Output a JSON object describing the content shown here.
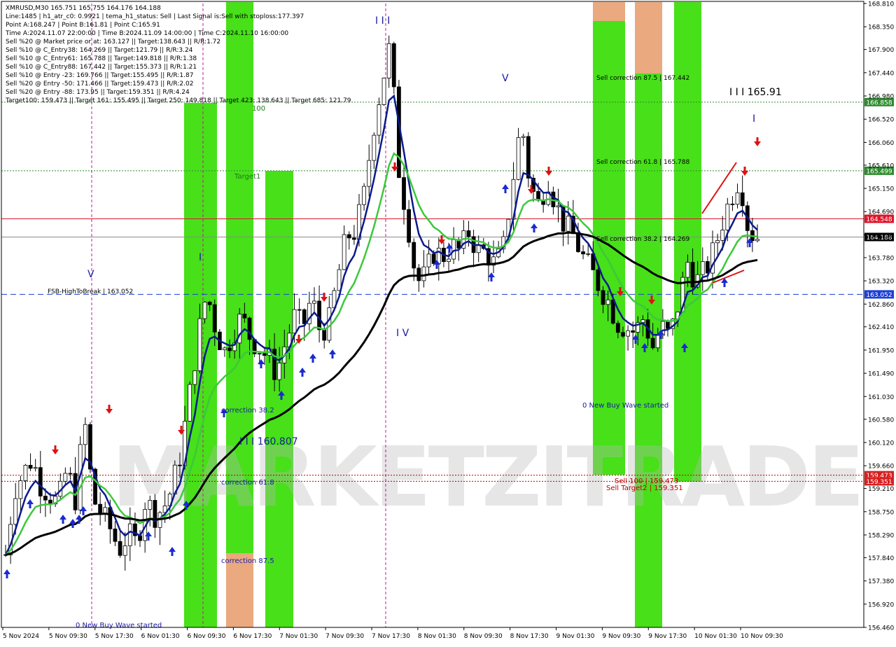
{
  "info_lines": [
    "XMRUSD,M30  165.751 165.755 164.176 164.188",
    "Line:1485  |  h1_atr_c0: 0.9921  |  tema_h1_status: Sell  |  Last Signal is:Sell with stoploss:177.397",
    "Point A:168.247  |  Point B:161.81  |  Point C:165.91",
    "Time A:2024.11.07 22:00:00  |  Time B:2024.11.09 14:00:00  |  Time C:2024.11.10 16:00:00",
    "Sell %20 @ Market price or at: 163.127  ||  Target:138.643  ||  R/R:1.72",
    "Sell %10 @ C_Entry38: 164.269  ||  Target:121.79  ||  R/R:3.24",
    "Sell %10 @ C_Entry61: 165.788  ||  Target:149.818  ||  R/R:1.38",
    "Sell %10 @ C_Entry88: 167.442  ||  Target:155.373  ||  R/R:1.21",
    "Sell %10 @ Entry -23: 169.766  ||  Target:155.495  ||  R/R:1.87",
    "Sell %20 @ Entry -50: 171.466  ||  Target:159.473  ||  R/R:2.02",
    "Sell %20 @ Entry -88: 173.95  ||  Target:159.351  ||  R/R:4.24",
    "Target100: 159.473  ||  Target 161: 155.495  ||  Target 250: 149.818  ||  Target 423: 138.643  ||  Target 685: 121.79"
  ],
  "chart_data": {
    "type": "candlestick",
    "symbol": "XMRUSD",
    "timeframe": "M30",
    "ylim": [
      156.46,
      168.81
    ],
    "price_ticks": [
      168.81,
      168.35,
      167.9,
      167.44,
      166.98,
      166.52,
      166.06,
      165.61,
      165.15,
      164.69,
      164.23,
      163.78,
      163.32,
      162.86,
      162.41,
      161.95,
      161.49,
      161.03,
      160.58,
      160.12,
      159.66,
      159.21,
      158.75,
      158.29,
      157.84,
      157.38,
      156.92,
      156.46
    ],
    "price_tick_labels": [
      "168.810",
      "168.350",
      "167.900",
      "167.440",
      "166.980",
      "166.520",
      "166.060",
      "165.610",
      "165.150",
      "164.690",
      "164.230",
      "163.780",
      "163.320",
      "162.860",
      "162.410",
      "161.950",
      "161.490",
      "161.030",
      "160.580",
      "160.120",
      "159.660",
      "159.210",
      "158.750",
      "158.290",
      "157.840",
      "157.380",
      "156.920",
      "156.460"
    ],
    "time_labels": [
      "5 Nov 2024",
      "5 Nov 09:30",
      "5 Nov 17:30",
      "6 Nov 01:30",
      "6 Nov 09:30",
      "6 Nov 17:30",
      "7 Nov 01:30",
      "7 Nov 09:30",
      "7 Nov 17:30",
      "8 Nov 01:30",
      "8 Nov 09:30",
      "8 Nov 17:30",
      "9 Nov 01:30",
      "9 Nov 09:30",
      "9 Nov 17:30",
      "10 Nov 01:30",
      "10 Nov 09:30"
    ],
    "close_path": [
      157.9,
      159.2,
      159.5,
      159.8,
      159.3,
      159.1,
      158.9,
      159.6,
      159.0,
      160.6,
      159.0,
      158.7,
      158.4,
      158.0,
      158.3,
      158.1,
      159.0,
      158.7,
      158.8,
      159.2,
      159.9,
      161.0,
      162.2,
      163.1,
      162.4,
      161.9,
      162.3,
      162.6,
      162.2,
      162.0,
      161.8,
      161.5,
      162.1,
      162.6,
      162.4,
      163.0,
      162.3,
      162.5,
      163.4,
      164.2,
      164.3,
      165.0,
      166.3,
      167.2,
      168.0,
      165.5,
      164.5,
      163.3,
      163.4,
      163.9,
      163.8,
      164.0,
      163.9,
      164.3,
      163.9,
      163.9,
      163.6,
      164.0,
      165.3,
      166.5,
      165.2,
      164.8,
      165.4,
      164.8,
      164.4,
      164.2,
      163.8,
      163.5,
      163.2,
      162.9,
      162.5,
      162.4,
      162.3,
      162.6,
      162.0,
      162.4,
      162.2,
      162.9,
      163.7,
      163.3,
      163.5,
      163.9,
      164.5,
      165.0,
      165.4,
      164.3,
      164.2
    ],
    "horizontal_levels": [
      {
        "price": 166.858,
        "label": "166.858",
        "badge_color": "#2e8b2e",
        "style": "dotted",
        "color": "#2e8b2e"
      },
      {
        "price": 165.499,
        "label": "165.499",
        "badge_color": "#2e8b2e",
        "style": "dotted",
        "color": "#2e8b2e"
      },
      {
        "price": 164.548,
        "label": "164.548",
        "badge_color": "#e0142a",
        "style": "solid",
        "color": "#e0142a"
      },
      {
        "price": 164.188,
        "label": "164.188",
        "badge_color": "#000000",
        "style": "solid",
        "color": "#8a8a8a"
      },
      {
        "price": 163.052,
        "label": "163.052",
        "badge_color": "#1c3fd6",
        "style": "dashed",
        "color": "#1c3fd6"
      },
      {
        "price": 159.473,
        "label": "159.473",
        "badge_color": "#d62020",
        "style": "dotted",
        "color": "#c00000"
      },
      {
        "price": 159.351,
        "label": "159.351",
        "badge_color": "#d62020",
        "style": "dotted",
        "color": "#c00000"
      }
    ],
    "annotations": {
      "fsb": "FSB-HighToBreak  |  163.052",
      "target1": "Target1",
      "label_100": "100",
      "wave_iii_low": "I I I 160.807",
      "wave_iii_top": "I I I",
      "wave_v": "V",
      "wave_iv": "I V",
      "wave_c": "I I I 165.91",
      "wave_i_right": "I",
      "wave_v_left": "V",
      "wave_i_left": "I",
      "corr_382": "correction 38.2",
      "corr_618": "correction 61.8",
      "corr_875": "correction 87.5",
      "sell_875": "Sell correction 87.5 | 167.442",
      "sell_618": "Sell correction 61.8 | 165.788",
      "sell_382": "Sell correction 38.2 | 164.269",
      "new_buy_wave_1": "0 New Buy Wave started",
      "new_buy_wave_2": "0 New Buy Wave started",
      "sell_100": "Sell 100 | 159.473",
      "sell_target2": "Sell Target2 | 159.351"
    },
    "watermark": "MARKETZITRADE",
    "colors": {
      "bull_candle": "#ffffff",
      "bear_candle": "#000000",
      "ma_navy": "#0b1a8c",
      "ma_green": "#3cc83c",
      "ma_black": "#000000",
      "zone_green": "#33dd00",
      "zone_orange": "#e8a070",
      "buy_arrow": "#1a2ad0",
      "sell_arrow": "#e01010",
      "session_line": "#c0189a"
    }
  }
}
